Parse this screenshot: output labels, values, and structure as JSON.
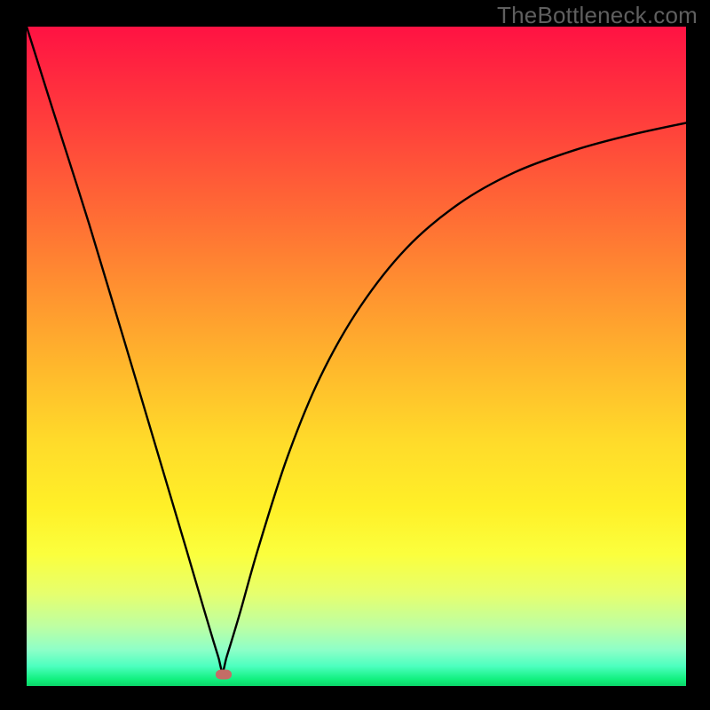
{
  "watermark": "TheBottleneck.com",
  "colors": {
    "frame": "#000000",
    "curve": "#000000",
    "marker": "#c46d66"
  },
  "chart_data": {
    "type": "line",
    "title": "",
    "xlabel": "",
    "ylabel": "",
    "xlim": [
      0,
      1
    ],
    "ylim": [
      0,
      1
    ],
    "grid": false,
    "legend": false,
    "notes": "Axes are unlabeled. Values are read as fractions of the plot width (x) and plot height (y). y=0 at bottom (green), y=1 at top (red). Curve dips to a sharp minimum near x≈0.297 then rises with decreasing slope toward the right edge.",
    "series": [
      {
        "name": "bottleneck-curve",
        "x": [
          0.0,
          0.04,
          0.095,
          0.148,
          0.201,
          0.242,
          0.269,
          0.283,
          0.291,
          0.297,
          0.303,
          0.311,
          0.325,
          0.351,
          0.395,
          0.445,
          0.505,
          0.576,
          0.655,
          0.74,
          0.832,
          0.917,
          1.0
        ],
        "y": [
          1.0,
          0.873,
          0.7,
          0.524,
          0.346,
          0.208,
          0.116,
          0.069,
          0.043,
          0.022,
          0.043,
          0.069,
          0.116,
          0.208,
          0.346,
          0.468,
          0.574,
          0.664,
          0.731,
          0.779,
          0.813,
          0.836,
          0.854
        ]
      }
    ],
    "marker": {
      "x": 0.299,
      "y": 0.018
    },
    "background_gradient_stops": [
      {
        "pos": 0.0,
        "color": "#ff1243"
      },
      {
        "pos": 0.14,
        "color": "#ff3d3c"
      },
      {
        "pos": 0.28,
        "color": "#ff6a35"
      },
      {
        "pos": 0.4,
        "color": "#ff9230"
      },
      {
        "pos": 0.52,
        "color": "#ffb92c"
      },
      {
        "pos": 0.63,
        "color": "#ffdb2a"
      },
      {
        "pos": 0.73,
        "color": "#fff028"
      },
      {
        "pos": 0.8,
        "color": "#fbff3d"
      },
      {
        "pos": 0.86,
        "color": "#e6ff6e"
      },
      {
        "pos": 0.91,
        "color": "#bdffa3"
      },
      {
        "pos": 0.945,
        "color": "#8effc8"
      },
      {
        "pos": 0.97,
        "color": "#4cffbf"
      },
      {
        "pos": 0.99,
        "color": "#11f07e"
      },
      {
        "pos": 1.0,
        "color": "#0bd568"
      }
    ]
  }
}
